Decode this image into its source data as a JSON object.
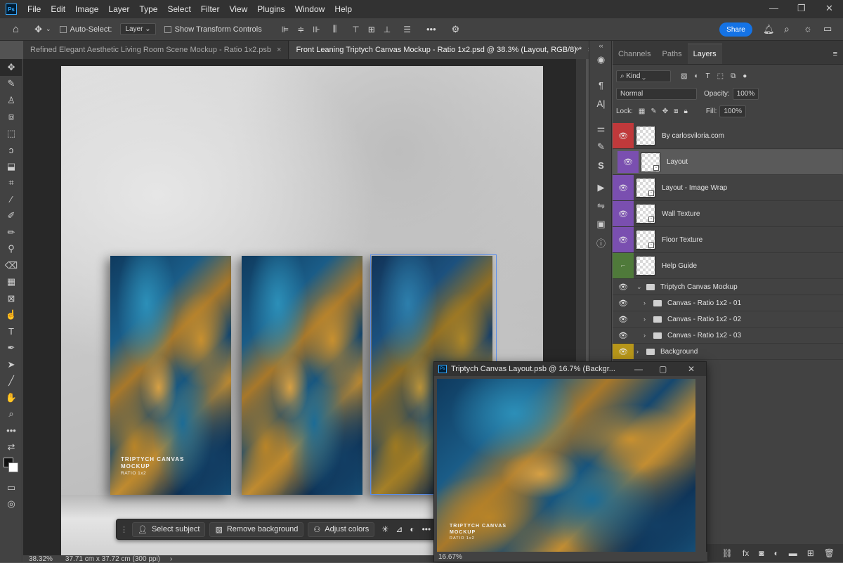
{
  "menubar": {
    "app_logo": "Ps",
    "items": [
      "File",
      "Edit",
      "Image",
      "Layer",
      "Type",
      "Select",
      "Filter",
      "View",
      "Plugins",
      "Window",
      "Help"
    ]
  },
  "options": {
    "auto_select_label": "Auto-Select:",
    "auto_select_value": "Layer",
    "show_transform_label": "Show Transform Controls",
    "share_label": "Share"
  },
  "tabs": [
    {
      "label": "Refined Elegant Aesthetic Living Room Scene Mockup - Ratio 1x2.psb",
      "close": "×"
    },
    {
      "label": "Front Leaning Triptych Canvas Mockup - Ratio 1x2.psd @ 38.3% (Layout, RGB/8) *",
      "close": "×"
    }
  ],
  "canvas": {
    "panel_text_line1": "TRIPTYCH CANVAS",
    "panel_text_line2": "MOCKUP",
    "panel_text_line3": "RATIO 1x2"
  },
  "contextbar": {
    "select_subject": "Select subject",
    "remove_background": "Remove background",
    "adjust_colors": "Adjust colors"
  },
  "status": {
    "zoom": "38.32%",
    "dimensions": "37.71 cm x 37.72 cm (300 ppi)"
  },
  "layers_panel": {
    "tabs": [
      "Channels",
      "Paths",
      "Layers"
    ],
    "filter_kind": "Kind",
    "blend_mode": "Normal",
    "opacity_label": "Opacity:",
    "opacity_value": "100%",
    "lock_label": "Lock:",
    "fill_label": "Fill:",
    "fill_value": "100%",
    "layers": [
      {
        "name": "By carlosviloria.com",
        "color": "#c0393b"
      },
      {
        "name": "Layout",
        "color": "#7a4fb0"
      },
      {
        "name": "Layout - Image Wrap",
        "color": "#7a4fb0"
      },
      {
        "name": "Wall Texture",
        "color": "#7a4fb0"
      },
      {
        "name": "Floor Texture",
        "color": "#7a4fb0"
      },
      {
        "name": "Help Guide",
        "color": "#4f7a3a"
      }
    ],
    "groups": [
      {
        "name": "Triptych Canvas Mockup"
      },
      {
        "name": "Canvas - Ratio 1x2 - 01"
      },
      {
        "name": "Canvas - Ratio 1x2 - 02"
      },
      {
        "name": "Canvas - Ratio 1x2 - 03"
      },
      {
        "name": "Background",
        "color": "#b7961a"
      }
    ]
  },
  "float_window": {
    "title": "Triptych Canvas Layout.psb @ 16.7% (Backgr...",
    "zoom": "16.67%",
    "panel_text_line1": "TRIPTYCH CANVAS",
    "panel_text_line2": "MOCKUP",
    "panel_text_line3": "RATIO 1x2"
  }
}
